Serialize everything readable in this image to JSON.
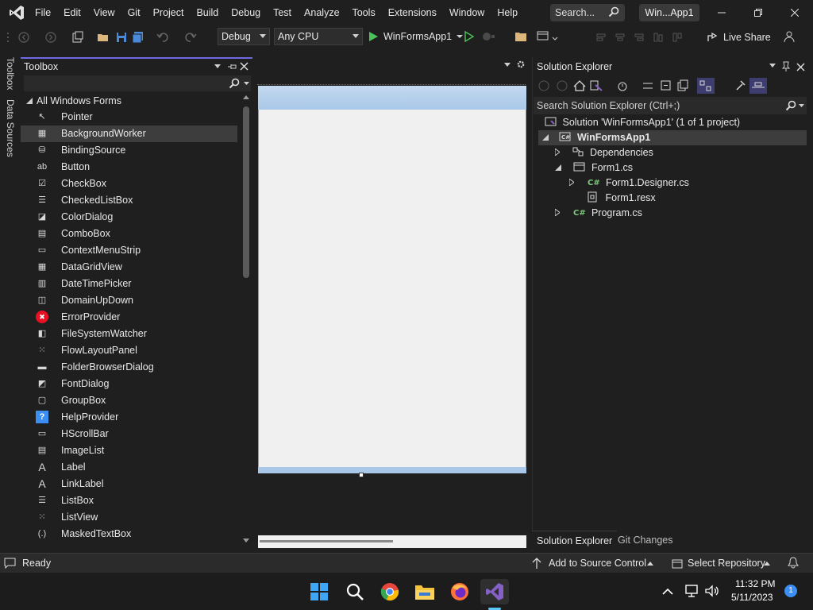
{
  "menu": {
    "items": [
      "File",
      "Edit",
      "View",
      "Git",
      "Project",
      "Build",
      "Debug",
      "Test",
      "Analyze",
      "Tools",
      "Extensions",
      "Window",
      "Help"
    ],
    "search_placeholder": "Search...",
    "window_title": "Win...App1"
  },
  "toolbar": {
    "config": "Debug",
    "platform": "Any CPU",
    "start_target": "WinFormsApp1",
    "live_share": "Live Share"
  },
  "side_tabs": [
    "Toolbox",
    "Data Sources"
  ],
  "toolbox": {
    "title": "Toolbox",
    "group": "All Windows Forms",
    "items": [
      {
        "label": "Pointer",
        "icon": "pointer-icon",
        "glyph": "↖"
      },
      {
        "label": "BackgroundWorker",
        "icon": "background-worker-icon",
        "glyph": "▦"
      },
      {
        "label": "BindingSource",
        "icon": "binding-source-icon",
        "glyph": "⛁"
      },
      {
        "label": "Button",
        "icon": "button-icon",
        "glyph": "ab"
      },
      {
        "label": "CheckBox",
        "icon": "checkbox-icon",
        "glyph": "☑"
      },
      {
        "label": "CheckedListBox",
        "icon": "checked-list-box-icon",
        "glyph": "☰"
      },
      {
        "label": "ColorDialog",
        "icon": "color-dialog-icon",
        "glyph": "◪"
      },
      {
        "label": "ComboBox",
        "icon": "combobox-icon",
        "glyph": "▤"
      },
      {
        "label": "ContextMenuStrip",
        "icon": "context-menu-strip-icon",
        "glyph": "▭"
      },
      {
        "label": "DataGridView",
        "icon": "data-grid-view-icon",
        "glyph": "▦"
      },
      {
        "label": "DateTimePicker",
        "icon": "date-time-picker-icon",
        "glyph": "▥"
      },
      {
        "label": "DomainUpDown",
        "icon": "domain-up-down-icon",
        "glyph": "◫"
      },
      {
        "label": "ErrorProvider",
        "icon": "error-provider-icon",
        "glyph": "✖"
      },
      {
        "label": "FileSystemWatcher",
        "icon": "file-system-watcher-icon",
        "glyph": "◧"
      },
      {
        "label": "FlowLayoutPanel",
        "icon": "flow-layout-panel-icon",
        "glyph": "⁙"
      },
      {
        "label": "FolderBrowserDialog",
        "icon": "folder-browser-dialog-icon",
        "glyph": "▬"
      },
      {
        "label": "FontDialog",
        "icon": "font-dialog-icon",
        "glyph": "◩"
      },
      {
        "label": "GroupBox",
        "icon": "group-box-icon",
        "glyph": "▢"
      },
      {
        "label": "HelpProvider",
        "icon": "help-provider-icon",
        "glyph": "?"
      },
      {
        "label": "HScrollBar",
        "icon": "hscrollbar-icon",
        "glyph": "▭"
      },
      {
        "label": "ImageList",
        "icon": "image-list-icon",
        "glyph": "▤"
      },
      {
        "label": "Label",
        "icon": "label-icon",
        "glyph": "A"
      },
      {
        "label": "LinkLabel",
        "icon": "link-label-icon",
        "glyph": "A"
      },
      {
        "label": "ListBox",
        "icon": "list-box-icon",
        "glyph": "☰"
      },
      {
        "label": "ListView",
        "icon": "list-view-icon",
        "glyph": "⁙"
      },
      {
        "label": "MaskedTextBox",
        "icon": "masked-textbox-icon",
        "glyph": "(.)"
      }
    ],
    "selected_index": 1
  },
  "solution_explorer": {
    "title": "Solution Explorer",
    "search_placeholder": "Search Solution Explorer (Ctrl+;)",
    "solution": "Solution 'WinFormsApp1' (1 of 1 project)",
    "project": "WinFormsApp1",
    "nodes": {
      "dependencies": "Dependencies",
      "form1": "Form1.cs",
      "form1_designer": "Form1.Designer.cs",
      "form1_resx": "Form1.resx",
      "program": "Program.cs"
    },
    "tabs": [
      "Solution Explorer",
      "Git Changes"
    ]
  },
  "status": {
    "state": "Ready",
    "source_control": "Add to Source Control",
    "repository": "Select Repository"
  },
  "taskbar": {
    "time": "11:32 PM",
    "date": "5/11/2023",
    "notifications": "1"
  },
  "colors": {
    "accent": "#6f6ae0",
    "vs_purple": "#8661c5",
    "run_green": "#4cc35a",
    "error_red": "#e81123",
    "form_title": "#a9c8e8"
  }
}
